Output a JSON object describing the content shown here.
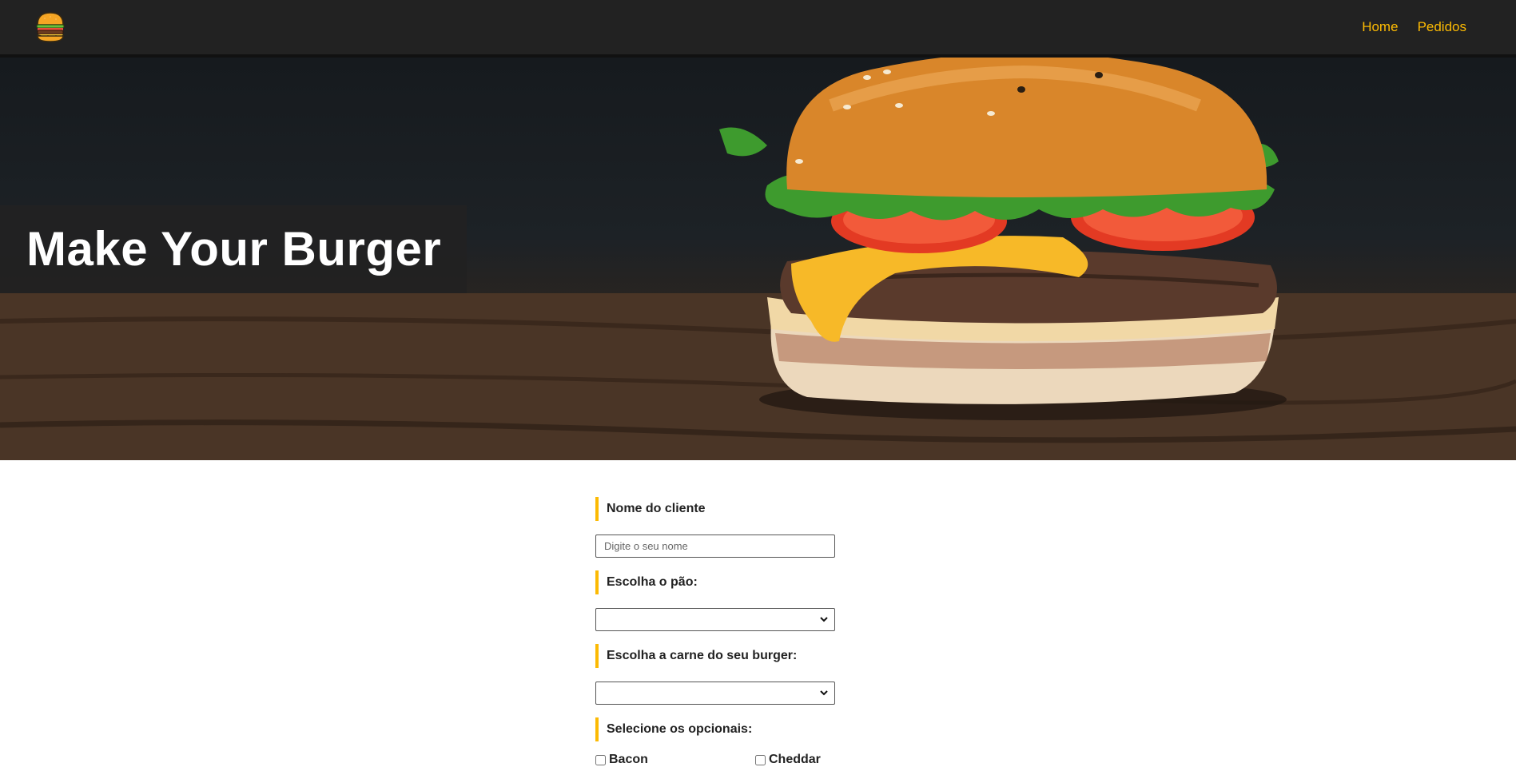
{
  "nav": {
    "logo_icon": "burger-icon",
    "links": [
      "Home",
      "Pedidos"
    ],
    "link_color": "#fcba03"
  },
  "hero": {
    "title": "Make Your Burger"
  },
  "form": {
    "name_label": "Nome do cliente",
    "name_placeholder": "Digite o seu nome",
    "name_value": "",
    "bread_label": "Escolha o pão:",
    "bread_selected": "",
    "meat_label": "Escolha a carne do seu burger:",
    "meat_selected": "",
    "optionals_label": "Selecione os opcionais:",
    "optionals": [
      {
        "label": "Bacon",
        "checked": false
      },
      {
        "label": "Cheddar",
        "checked": false
      }
    ]
  },
  "colors": {
    "accent": "#fcba03",
    "navbar": "#222222"
  }
}
